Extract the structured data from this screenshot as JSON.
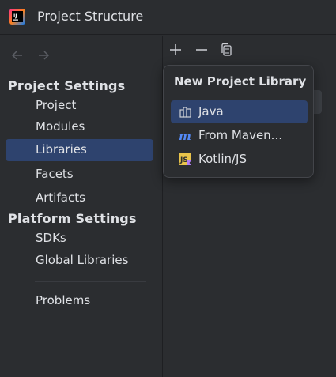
{
  "window": {
    "title": "Project Structure",
    "app_icon_label": "IJ"
  },
  "colors": {
    "background": "#2b2d30",
    "selection": "#2e436e",
    "text": "#dfe1e5",
    "muted_icon": "#6f737a",
    "divider": "#1e1f22"
  },
  "sidebar": {
    "nav": {
      "back_icon": "arrow-left-icon",
      "forward_icon": "arrow-right-icon"
    },
    "sections": [
      {
        "header": "Project Settings",
        "items": [
          {
            "label": "Project",
            "selected": false
          },
          {
            "label": "Modules",
            "selected": false
          },
          {
            "label": "Libraries",
            "selected": true
          },
          {
            "label": "Facets",
            "selected": false
          },
          {
            "label": "Artifacts",
            "selected": false
          }
        ]
      },
      {
        "header": "Platform Settings",
        "items": [
          {
            "label": "SDKs",
            "selected": false
          },
          {
            "label": "Global Libraries",
            "selected": false
          }
        ]
      }
    ],
    "extra_items": [
      {
        "label": "Problems",
        "selected": false
      }
    ]
  },
  "toolbar": {
    "buttons": [
      {
        "icon": "plus-icon"
      },
      {
        "icon": "minus-icon"
      },
      {
        "icon": "copy-icon"
      }
    ]
  },
  "popup": {
    "title": "New Project Library",
    "items": [
      {
        "label": "Java",
        "icon": "library-icon",
        "selected": true
      },
      {
        "label": "From Maven...",
        "icon": "maven-icon",
        "selected": false
      },
      {
        "label": "Kotlin/JS",
        "icon": "kotlin-js-icon",
        "selected": false
      }
    ]
  }
}
